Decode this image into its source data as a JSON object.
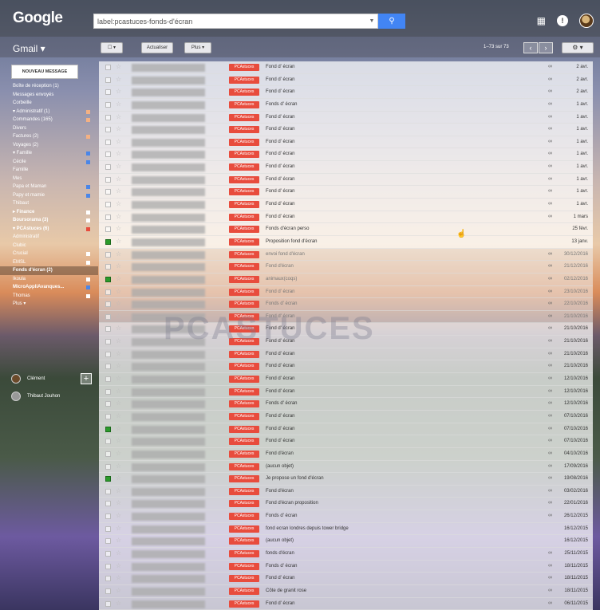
{
  "header": {
    "logo": "Google",
    "search_query": "label:pcastuces-fonds-d'écran",
    "search_button_icon": "search-icon",
    "apps_icon": "apps-grid-icon",
    "notifications_icon": "notifications-icon",
    "avatar_icon": "avatar"
  },
  "toolbar": {
    "gmail_label": "Gmail ▾",
    "select_label": "☐ ▾",
    "refresh_label": "Actualiser",
    "more_label": "Plus ▾",
    "count_text": "1–73 sur 73",
    "prev_icon": "‹",
    "next_icon": "›",
    "settings_icon": "⚙ ▾"
  },
  "sidebar": {
    "compose_label": "NOUVEAU MESSAGE",
    "items": [
      {
        "label": "Boîte de réception (1)",
        "bold": false,
        "sel": false,
        "color": ""
      },
      {
        "label": "Messages envoyés",
        "bold": false,
        "sel": false,
        "color": ""
      },
      {
        "label": "Corbeille",
        "bold": false,
        "sel": false,
        "color": ""
      },
      {
        "label": "▾ Administratif (1)",
        "bold": false,
        "sel": false,
        "color": "#f4b183"
      },
      {
        "label": "      Commandes (165)",
        "bold": false,
        "sel": false,
        "color": "#f4b183"
      },
      {
        "label": "      Divers",
        "bold": false,
        "sel": false,
        "color": ""
      },
      {
        "label": "      Factures (2)",
        "bold": false,
        "sel": false,
        "color": "#f4b183"
      },
      {
        "label": "      Voyages (2)",
        "bold": false,
        "sel": false,
        "color": ""
      },
      {
        "label": "▾ Famille",
        "bold": false,
        "sel": false,
        "color": "#4a86e8"
      },
      {
        "label": "      Cécile",
        "bold": false,
        "sel": false,
        "color": "#4a86e8"
      },
      {
        "label": "      Famille",
        "bold": false,
        "sel": false,
        "color": ""
      },
      {
        "label": "      Mes",
        "bold": false,
        "sel": false,
        "color": ""
      },
      {
        "label": "      Papa et Maman",
        "bold": false,
        "sel": false,
        "color": "#4a86e8"
      },
      {
        "label": "      Papy et mamie",
        "bold": false,
        "sel": false,
        "color": "#4a86e8"
      },
      {
        "label": "      Thibaut",
        "bold": false,
        "sel": false,
        "color": ""
      },
      {
        "label": "▸ Finance",
        "bold": true,
        "sel": false,
        "color": "#ffffff"
      },
      {
        "label": "      Boursorama (3)",
        "bold": true,
        "sel": false,
        "color": "#ffffff"
      },
      {
        "label": "▾ PCAstuces (6)",
        "bold": true,
        "sel": false,
        "color": "#e84c3d"
      },
      {
        "label": "      Administratif",
        "bold": false,
        "sel": false,
        "color": ""
      },
      {
        "label": "      Clubic",
        "bold": false,
        "sel": false,
        "color": ""
      },
      {
        "label": "      Crucial",
        "bold": false,
        "sel": false,
        "color": "#ffffff"
      },
      {
        "label": "      EMSL",
        "bold": false,
        "sel": false,
        "color": "#ffffff"
      },
      {
        "label": "      Fonds d'écran (2)",
        "bold": true,
        "sel": true,
        "color": ""
      },
      {
        "label": "      Ikoula",
        "bold": false,
        "sel": false,
        "color": "#ffffff"
      },
      {
        "label": "      MicroAppliAvanques...",
        "bold": true,
        "sel": false,
        "color": "#4a86e8"
      },
      {
        "label": "      Thomas",
        "bold": false,
        "sel": false,
        "color": "#ffffff"
      },
      {
        "label": "Plus ▾",
        "bold": false,
        "sel": false,
        "color": ""
      }
    ]
  },
  "hangouts": {
    "me": "Clément",
    "contact": "Thibaut Jouhon",
    "add_icon": "+"
  },
  "watermark": "PCASTUCES",
  "label_tag": "PCAstuces",
  "emails": [
    {
      "subject": "Fond d' écran",
      "date": "2 avr.",
      "read": false,
      "checked": false,
      "attach": true
    },
    {
      "subject": "Fond d' écran",
      "date": "2 avr.",
      "read": false,
      "checked": false,
      "attach": true
    },
    {
      "subject": "Fond d' écran",
      "date": "2 avr.",
      "read": false,
      "checked": false,
      "attach": true
    },
    {
      "subject": "Fonds d' écran",
      "date": "1 avr.",
      "read": false,
      "checked": false,
      "attach": true
    },
    {
      "subject": "Fond d' écran",
      "date": "1 avr.",
      "read": false,
      "checked": false,
      "attach": true
    },
    {
      "subject": "Fond d' écran",
      "date": "1 avr.",
      "read": false,
      "checked": false,
      "attach": true
    },
    {
      "subject": "Fond d' écran",
      "date": "1 avr.",
      "read": false,
      "checked": false,
      "attach": true
    },
    {
      "subject": "Fond d' écran",
      "date": "1 avr.",
      "read": false,
      "checked": false,
      "attach": true
    },
    {
      "subject": "Fond d' écran",
      "date": "1 avr.",
      "read": false,
      "checked": false,
      "attach": true
    },
    {
      "subject": "Fond d' écran",
      "date": "1 avr.",
      "read": false,
      "checked": false,
      "attach": true
    },
    {
      "subject": "Fond d' écran",
      "date": "1 avr.",
      "read": false,
      "checked": false,
      "attach": true
    },
    {
      "subject": "Fond d' écran",
      "date": "1 avr.",
      "read": false,
      "checked": false,
      "attach": true
    },
    {
      "subject": "Fond d' écran",
      "date": "1 mars",
      "read": false,
      "checked": false,
      "attach": true
    },
    {
      "subject": "Fonds d'écran perso",
      "date": "25 févr.",
      "read": false,
      "checked": false,
      "attach": false
    },
    {
      "subject": "Proposition fond d'écran",
      "date": "13 janv.",
      "read": false,
      "checked": true,
      "attach": false
    },
    {
      "subject": "envoi fond d'écran",
      "date": "30/12/2016",
      "read": true,
      "checked": false,
      "attach": true
    },
    {
      "subject": "Fond d'écran",
      "date": "21/12/2016",
      "read": true,
      "checked": false,
      "attach": true
    },
    {
      "subject": "animaux(coqs)",
      "date": "02/12/2016",
      "read": true,
      "checked": true,
      "attach": true
    },
    {
      "subject": "Fond d' écran",
      "date": "23/10/2016",
      "read": true,
      "checked": false,
      "attach": true
    },
    {
      "subject": "Fonds d' écran",
      "date": "22/10/2016",
      "read": true,
      "checked": false,
      "attach": true
    },
    {
      "subject": "Fond d' écran",
      "date": "21/10/2016",
      "read": true,
      "checked": false,
      "attach": true
    },
    {
      "subject": "Fond d' écran",
      "date": "21/10/2016",
      "read": false,
      "checked": false,
      "attach": true
    },
    {
      "subject": "Fond d' écran",
      "date": "21/10/2016",
      "read": false,
      "checked": false,
      "attach": true
    },
    {
      "subject": "Fond d' écran",
      "date": "21/10/2016",
      "read": false,
      "checked": false,
      "attach": true
    },
    {
      "subject": "Fond d' écran",
      "date": "21/10/2016",
      "read": false,
      "checked": false,
      "attach": true
    },
    {
      "subject": "Fond d' écran",
      "date": "12/10/2016",
      "read": false,
      "checked": false,
      "attach": true
    },
    {
      "subject": "Fond d' écran",
      "date": "12/10/2016",
      "read": false,
      "checked": false,
      "attach": true
    },
    {
      "subject": "Fonds d' écran",
      "date": "12/10/2016",
      "read": false,
      "checked": false,
      "attach": true
    },
    {
      "subject": "Fond d' écran",
      "date": "07/10/2016",
      "read": false,
      "checked": false,
      "attach": true
    },
    {
      "subject": "Fond d' écran",
      "date": "07/10/2016",
      "read": false,
      "checked": true,
      "attach": true
    },
    {
      "subject": "Fond d' écran",
      "date": "07/10/2016",
      "read": false,
      "checked": false,
      "attach": true
    },
    {
      "subject": "Fond d'écran",
      "date": "04/10/2016",
      "read": false,
      "checked": false,
      "attach": true
    },
    {
      "subject": "(aucun objet)",
      "date": "17/09/2016",
      "read": false,
      "checked": false,
      "attach": true
    },
    {
      "subject": "Je propose un fond d'écran",
      "date": "19/08/2016",
      "read": false,
      "checked": true,
      "attach": true
    },
    {
      "subject": "Fond d'écran",
      "date": "03/02/2016",
      "read": false,
      "checked": false,
      "attach": true
    },
    {
      "subject": "Fond d'écran proposition",
      "date": "22/01/2016",
      "read": false,
      "checked": false,
      "attach": true
    },
    {
      "subject": "Fonds d' écran",
      "date": "26/12/2015",
      "read": false,
      "checked": false,
      "attach": true
    },
    {
      "subject": "fond ecran londres depuis tower bridge",
      "date": "16/12/2015",
      "read": false,
      "checked": false,
      "attach": false
    },
    {
      "subject": "(aucun objet)",
      "date": "16/12/2015",
      "read": false,
      "checked": false,
      "attach": false
    },
    {
      "subject": "fonds d'écran",
      "date": "25/11/2015",
      "read": false,
      "checked": false,
      "attach": true
    },
    {
      "subject": "Fonds d' écran",
      "date": "18/11/2015",
      "read": false,
      "checked": false,
      "attach": true
    },
    {
      "subject": "Fond d' écran",
      "date": "18/11/2015",
      "read": false,
      "checked": false,
      "attach": true
    },
    {
      "subject": "Côte de granit rose",
      "date": "18/11/2015",
      "read": false,
      "checked": false,
      "attach": true
    },
    {
      "subject": "Fond d' écran",
      "date": "06/11/2015",
      "read": false,
      "checked": false,
      "attach": true
    }
  ]
}
